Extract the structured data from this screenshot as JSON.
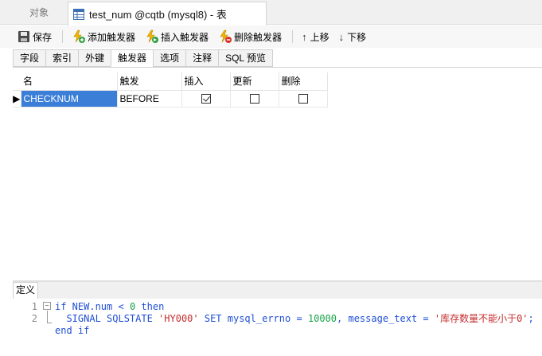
{
  "tabs": {
    "objects_label": "对象",
    "document_title": "test_num @cqtb (mysql8) - 表"
  },
  "toolbar": {
    "save": "保存",
    "add_trigger": "添加触发器",
    "insert_trigger": "插入触发器",
    "delete_trigger": "删除触发器",
    "move_up": "上移",
    "move_down": "下移"
  },
  "subtabs": [
    "字段",
    "索引",
    "外键",
    "触发器",
    "选项",
    "注释",
    "SQL 预览"
  ],
  "subtab_active": "触发器",
  "grid": {
    "columns": [
      "名",
      "触发",
      "插入",
      "更新",
      "删除"
    ],
    "rows": [
      {
        "name": "CHECKNUM",
        "timing": "BEFORE",
        "insert": true,
        "update": false,
        "delete": false
      }
    ]
  },
  "definition": {
    "tab_label": "定义",
    "lines": [
      {
        "no": "1",
        "tokens": [
          [
            "kw",
            "if"
          ],
          [
            "txt",
            " NEW.num < "
          ],
          [
            "num",
            "0"
          ],
          [
            "kw",
            " then"
          ]
        ]
      },
      {
        "no": "2",
        "tokens": [
          [
            "txt",
            "  "
          ],
          [
            "kw",
            "SIGNAL SQLSTATE "
          ],
          [
            "str",
            "'HY000'"
          ],
          [
            "kw",
            " SET "
          ],
          [
            "txt",
            "mysql_errno = "
          ],
          [
            "num",
            "10000"
          ],
          [
            "txt",
            ", message_text = "
          ],
          [
            "str",
            "'库存数量不能小于0'"
          ],
          [
            "txt",
            ";"
          ]
        ]
      },
      {
        "no": "",
        "tokens": [
          [
            "kw",
            "end if"
          ]
        ]
      }
    ]
  },
  "colors": {
    "selection": "#3a7ed8",
    "keyword": "#1f4fd6",
    "number": "#1aa34a",
    "string": "#c72e2e"
  }
}
